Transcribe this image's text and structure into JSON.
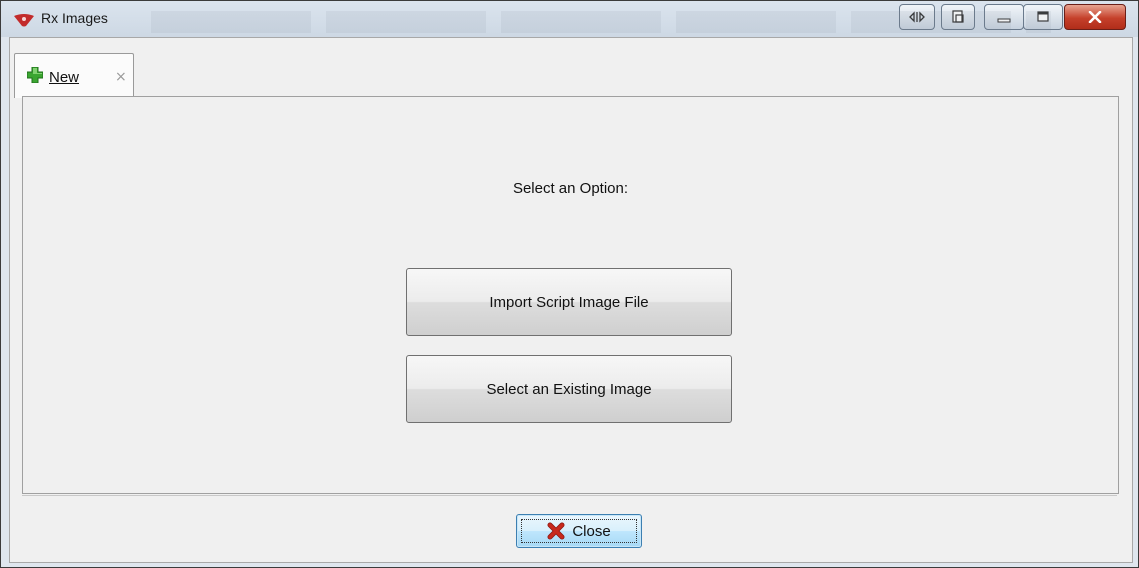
{
  "window": {
    "title": "Rx Images",
    "controls": {
      "restore_icon": "restore-down-icon",
      "maximize_icon": "maximize-icon",
      "close_icon": "window-close-icon"
    }
  },
  "tabs": [
    {
      "label": "New",
      "icon": "green-plus-icon",
      "close": "×"
    }
  ],
  "main": {
    "prompt": "Select an Option:",
    "buttons": [
      {
        "label": "Import Script Image File"
      },
      {
        "label": "Select an Existing Image"
      }
    ]
  },
  "footer": {
    "close_label": "Close",
    "close_icon": "red-x-icon"
  },
  "colors": {
    "close_accent": "#c5402b",
    "plus_green": "#3aa530",
    "x_red": "#c8291d"
  }
}
